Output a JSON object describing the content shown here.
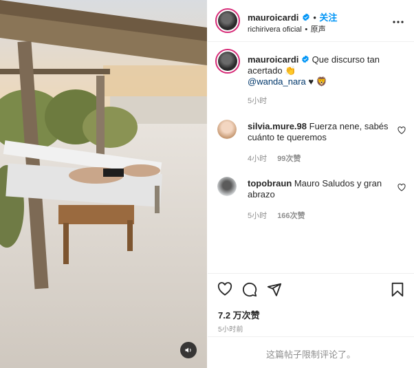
{
  "post": {
    "author": "mauroicardi",
    "follow_label": "关注",
    "dot": "•",
    "music_source": "richirivera oficial",
    "audio_label": "原声",
    "location_sep": "•",
    "caption": {
      "username": "mauroicardi",
      "text": "Que discurso tan acertado",
      "emoji_clap": "👏",
      "mention": "@wanda_nara",
      "emoji_heart": "♥",
      "emoji_lion": "🦁",
      "time": "5小时"
    },
    "comments": [
      {
        "username": "silvia.mure.98",
        "text": "Fuerza nene, sabés cuánto te queremos",
        "time": "4小时",
        "likes": "99次赞"
      },
      {
        "username": "topobraun",
        "text": "Mauro Saludos y gran abrazo",
        "time": "5小时",
        "likes": "166次赞"
      }
    ],
    "like_count": "7.2 万次赞",
    "posted_ago": "5小时前",
    "comments_limited": "这篇帖子限制评论了。"
  },
  "colors": {
    "accent": "#0095f6",
    "verified": "#0095f6",
    "ring": "#d62976",
    "muted": "#8e8e8e"
  },
  "icons": [
    "heart-icon",
    "comment-icon",
    "share-icon",
    "bookmark-icon",
    "more-icon",
    "mute-icon",
    "verified-icon"
  ]
}
